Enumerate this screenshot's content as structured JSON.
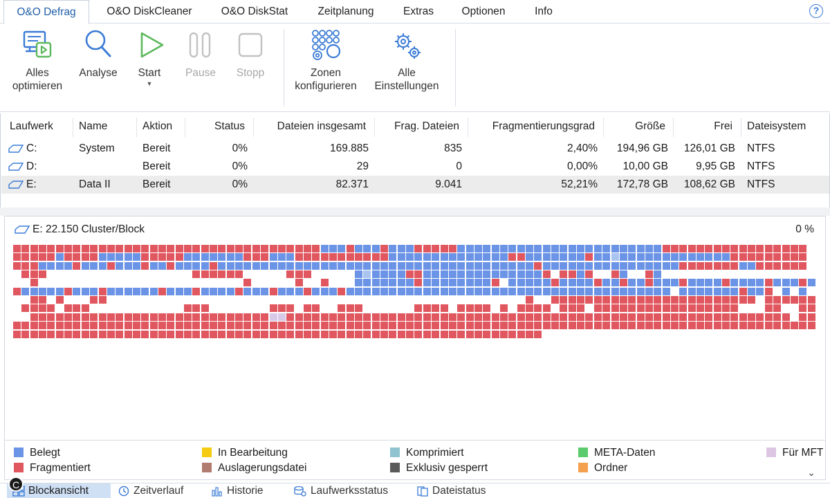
{
  "menu": {
    "tabs": [
      {
        "label": "O&O Defrag",
        "active": true
      },
      {
        "label": "O&O DiskCleaner"
      },
      {
        "label": "O&O DiskStat"
      },
      {
        "label": "Zeitplanung"
      },
      {
        "label": "Extras"
      },
      {
        "label": "Optionen"
      },
      {
        "label": "Info"
      }
    ],
    "help": "?"
  },
  "ribbon": {
    "alles_optimieren": {
      "line1": "Alles",
      "line2": "optimieren"
    },
    "analyse": "Analyse",
    "start": "Start",
    "pause": "Pause",
    "stopp": "Stopp",
    "zonen": {
      "line1": "Zonen",
      "line2": "konfigurieren"
    },
    "einstellungen": {
      "line1": "Alle",
      "line2": "Einstellungen"
    }
  },
  "table": {
    "columns": [
      "Laufwerk",
      "Name",
      "Aktion",
      "Status",
      "Dateien insgesamt",
      "Frag. Dateien",
      "Fragmentierungsgrad",
      "Größe",
      "Frei",
      "Dateisystem"
    ],
    "rows": [
      {
        "drive": "C:",
        "name": "System",
        "action": "Bereit",
        "status": "0%",
        "files": "169.885",
        "frag": "835",
        "degree": "2,40%",
        "size": "194,96 GB",
        "free": "126,01 GB",
        "fs": "NTFS"
      },
      {
        "drive": "D:",
        "name": "",
        "action": "Bereit",
        "status": "0%",
        "files": "29",
        "frag": "0",
        "degree": "0,00%",
        "size": "10,00 GB",
        "free": "9,95 GB",
        "fs": "NTFS"
      },
      {
        "drive": "E:",
        "name": "Data II",
        "action": "Bereit",
        "status": "0%",
        "files": "82.371",
        "frag": "9.041",
        "degree": "52,21%",
        "size": "172,78 GB",
        "free": "108,62 GB",
        "fs": "NTFS",
        "selected": true
      }
    ]
  },
  "blockview": {
    "header": "E: 22.150 Cluster/Block",
    "percent": "0 %"
  },
  "legend": [
    {
      "label": "Belegt",
      "color": "#6b93e6"
    },
    {
      "label": "Fragmentiert",
      "color": "#e0575f"
    },
    {
      "label": "In Bearbeitung",
      "color": "#f5cc12"
    },
    {
      "label": "Auslagerungsdatei",
      "color": "#b07c70"
    },
    {
      "label": "Komprimiert",
      "color": "#8fc3cf"
    },
    {
      "label": "Exklusiv gesperrt",
      "color": "#5a5a5a"
    },
    {
      "label": "META-Daten",
      "color": "#5ccb6e"
    },
    {
      "label": "Ordner",
      "color": "#f5a04e"
    },
    {
      "label": "Für MFT",
      "color": "#dcc6e3"
    }
  ],
  "bottom_tabs": [
    {
      "label": "Blockansicht",
      "active": true
    },
    {
      "label": "Zeitverlauf"
    },
    {
      "label": "Historie"
    },
    {
      "label": "Laufwerksstatus"
    },
    {
      "label": "Dateistatus"
    }
  ],
  "badge": "C"
}
